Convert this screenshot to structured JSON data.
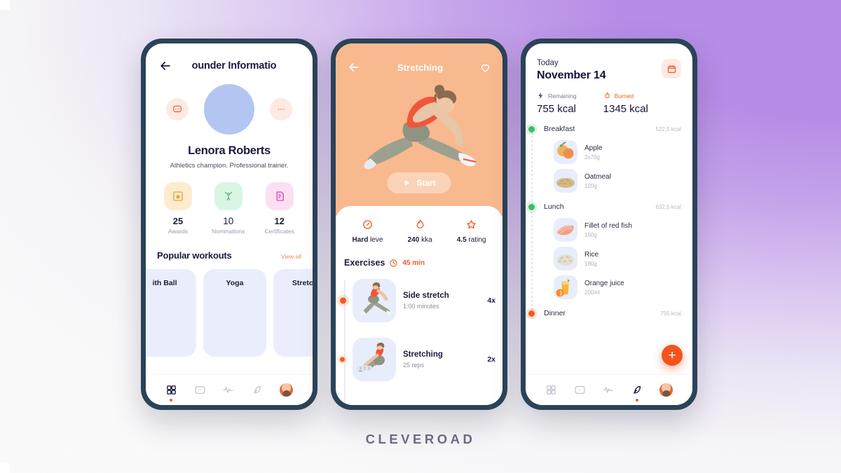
{
  "brand": {
    "name": "CLEVEROAD"
  },
  "profile_screen": {
    "header_title": "ounder Informatio",
    "back_icon": "arrow-left-icon",
    "message_icon": "chat-bubble-icon",
    "more_icon": "ellipsis-icon",
    "name": "Lenora Roberts",
    "bio": "Athletics champion. Professional trainer.",
    "stats": [
      {
        "value": "25",
        "label": "Awards",
        "icon": "award-badge-icon"
      },
      {
        "value": "10",
        "label": "Nominations",
        "icon": "celebrating-person-icon"
      },
      {
        "value": "12",
        "label": "Certificates",
        "icon": "certificate-document-icon"
      }
    ],
    "section_title": "Popular workouts",
    "view_all": "View all",
    "cards": [
      {
        "title": "ith Ball"
      },
      {
        "title": "Yoga"
      },
      {
        "title": "Stretch"
      }
    ]
  },
  "workout_screen": {
    "title": "Stretching",
    "back_icon": "arrow-left-icon",
    "favorite_icon": "heart-icon",
    "start_label": "Start",
    "play_icon": "play-icon",
    "stats": [
      {
        "icon": "speedometer-icon",
        "bold": "Hard",
        "rest": "leve"
      },
      {
        "icon": "flame-icon",
        "bold": "240",
        "rest": "kka"
      },
      {
        "icon": "star-icon",
        "bold": "4.5",
        "rest": "rating"
      }
    ],
    "exercises_title": "Exercises",
    "clock_icon": "clock-icon",
    "duration": "45 min",
    "exercises": [
      {
        "name": "Side stretch",
        "sub": "1:00 minutes",
        "count": "4x"
      },
      {
        "name": "Stretching",
        "sub": "25 reps",
        "count": "2x"
      }
    ]
  },
  "nutrition_screen": {
    "today_label": "Today",
    "date": "November 14",
    "calendar_icon": "calendar-icon",
    "remaining": {
      "icon": "lightning-bolt-icon",
      "label": "Remaining",
      "value": "755 kcal"
    },
    "burned": {
      "icon": "flame-icon",
      "label": "Burned",
      "value": "1345 kcal"
    },
    "meals": [
      {
        "name": "Breakfast",
        "kcal": "522,5 kcal",
        "status_color": "#3fbd5f",
        "foods": [
          {
            "name": "Apple",
            "amount": "2x70g",
            "icon": "apple-icon"
          },
          {
            "name": "Oatmeal",
            "amount": "120g",
            "icon": "oatmeal-icon"
          }
        ]
      },
      {
        "name": "Lunch",
        "kcal": "632,5 kcal",
        "status_color": "#3fbd5f",
        "foods": [
          {
            "name": "Fillet of red fish",
            "amount": "150g",
            "icon": "salmon-fillet-icon"
          },
          {
            "name": "Rice",
            "amount": "180g",
            "icon": "rice-icon"
          },
          {
            "name": "Orange juice",
            "amount": "200ml",
            "icon": "orange-juice-icon"
          }
        ]
      },
      {
        "name": "Dinner",
        "kcal": "755 kcal",
        "status_color": "#f25c1f",
        "foods": []
      }
    ],
    "add_label": "+"
  },
  "bottom_nav": {
    "items": [
      {
        "icon": "grid-dashboard-icon"
      },
      {
        "icon": "chat-bubble-icon"
      },
      {
        "icon": "activity-pulse-icon"
      },
      {
        "icon": "leaf-nutrition-icon"
      },
      {
        "icon": "user-avatar-icon"
      }
    ],
    "active_profile": 0,
    "active_nutrition": 3
  },
  "colors": {
    "accent_orange": "#f25c1f",
    "peach": "#f8b98f",
    "navy": "#1b1b3f",
    "frame": "#2b4358",
    "card_blue": "#eaeefc",
    "purple_bg": "#b68ae8"
  }
}
